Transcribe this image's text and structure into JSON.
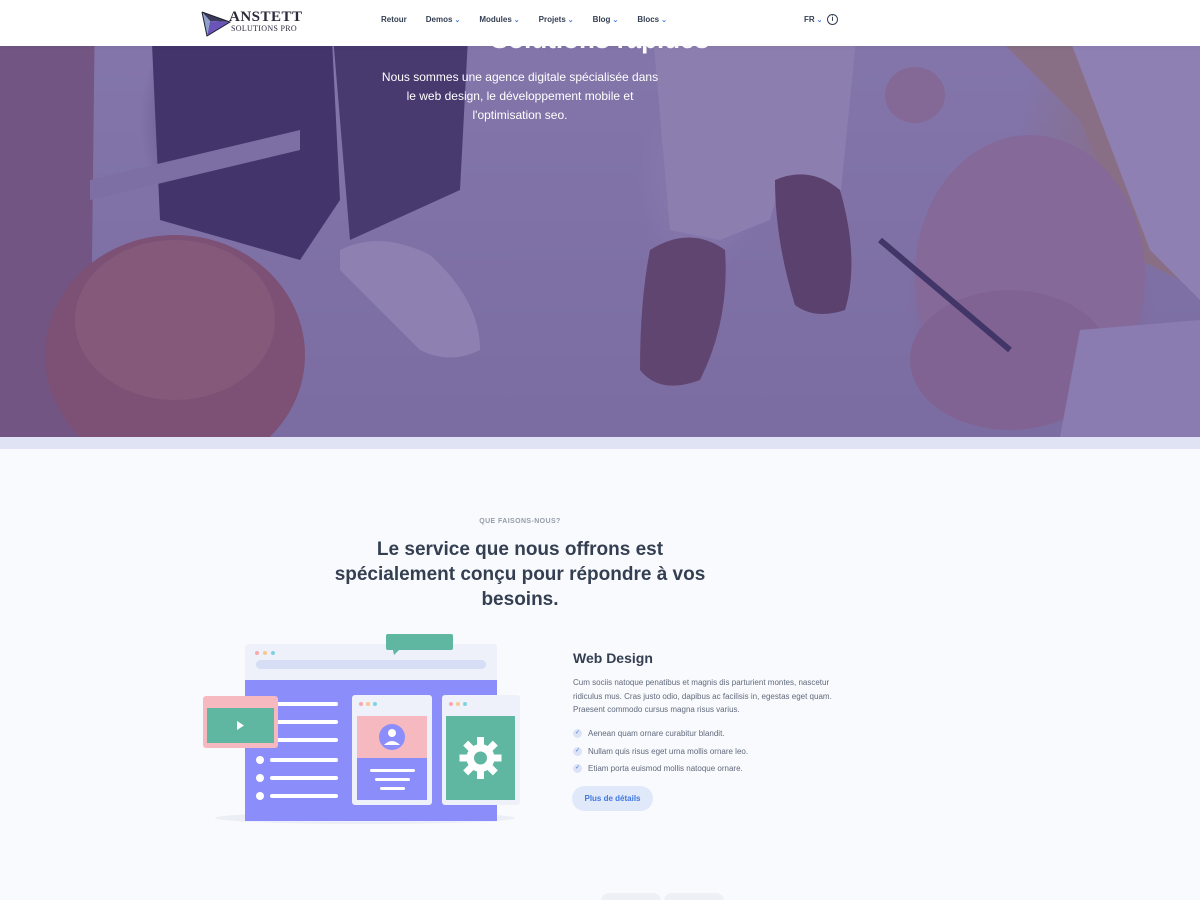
{
  "navbar": {
    "logo_title": "ANSTETT",
    "logo_subtitle": "SOLUTIONS PRO",
    "menu": [
      {
        "label": "Retour",
        "has_dropdown": false
      },
      {
        "label": "Demos",
        "has_dropdown": true
      },
      {
        "label": "Modules",
        "has_dropdown": true
      },
      {
        "label": "Projets",
        "has_dropdown": true
      },
      {
        "label": "Blog",
        "has_dropdown": true
      },
      {
        "label": "Blocs",
        "has_dropdown": true
      }
    ],
    "language": "FR",
    "info_icon": "info-icon"
  },
  "hero": {
    "title": "Solutions rapides",
    "text": "Nous sommes une agence digitale spécialisée dans le web design, le développement mobile et l'optimisation seo."
  },
  "section": {
    "kicker": "QUE FAISONS-NOUS?",
    "title": "Le service que nous offrons est spécialement conçu pour répondre à vos besoins."
  },
  "service": {
    "title": "Web Design",
    "description": "Cum sociis natoque penatibus et magnis dis parturient montes, nascetur ridiculus mus. Cras justo odio, dapibus ac facilisis in, egestas eget quam. Praesent commodo cursus magna risus varius.",
    "items": [
      "Aenean quam ornare curabitur blandit.",
      "Nullam quis risus eget urna mollis ornare leo.",
      "Etiam porta euismod mollis natoque ornare."
    ],
    "button_label": "Plus de détails"
  },
  "colors": {
    "primary": "#3f78e0",
    "hero_overlay": "#503c8c",
    "illustration_purple": "#8b8dfa",
    "illustration_green": "#5fb6a1",
    "illustration_pink": "#f7b9c0"
  }
}
